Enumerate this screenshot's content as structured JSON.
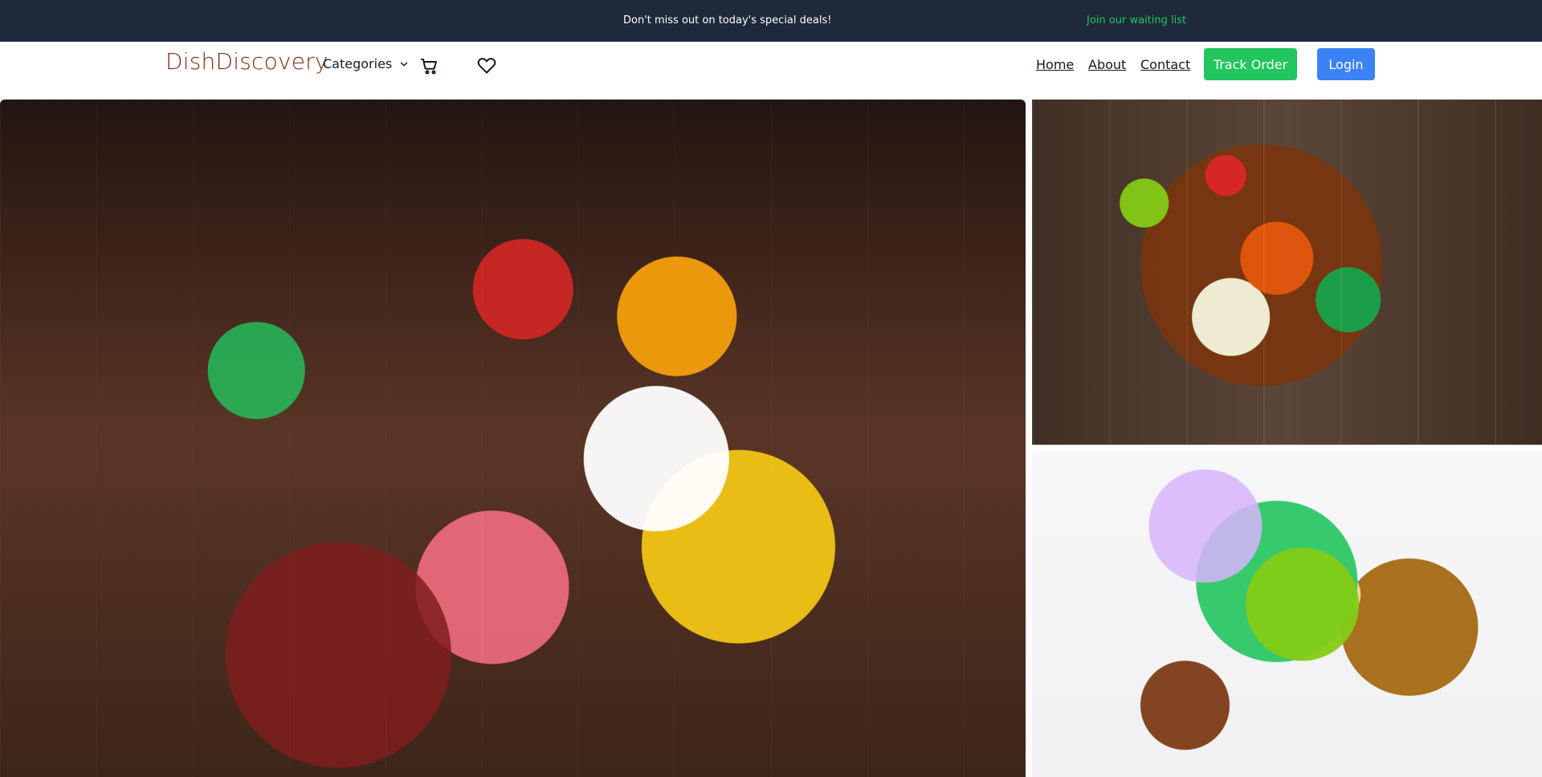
{
  "topbar": {
    "promo_text": "Don't miss out on today's special deals!",
    "waitlist_link": "Join our waiting list"
  },
  "nav": {
    "brand": "DishDiscovery",
    "categories_label": "Categories",
    "links": {
      "home": "Home",
      "about": "About",
      "contact": "Contact"
    },
    "buttons": {
      "track_order": "Track Order",
      "login": "Login"
    },
    "icons": {
      "cart": "cart-icon",
      "favorites": "heart-icon",
      "categories_chevron": "chevron-down-icon"
    }
  },
  "colors": {
    "topbar_bg": "#1e293b",
    "waitlist_link": "#22c55e",
    "brand": "#7c2d12",
    "track_button": "#22c55e",
    "login_button": "#3b82f6"
  }
}
